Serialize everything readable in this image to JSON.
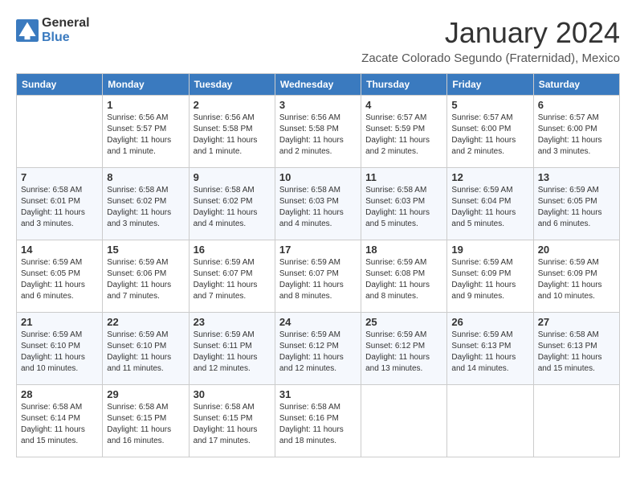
{
  "logo": {
    "general": "General",
    "blue": "Blue"
  },
  "title": {
    "month": "January 2024",
    "location": "Zacate Colorado Segundo (Fraternidad), Mexico"
  },
  "weekdays": [
    "Sunday",
    "Monday",
    "Tuesday",
    "Wednesday",
    "Thursday",
    "Friday",
    "Saturday"
  ],
  "weeks": [
    [
      {
        "day": "",
        "sunrise": "",
        "sunset": "",
        "daylight": ""
      },
      {
        "day": "1",
        "sunrise": "Sunrise: 6:56 AM",
        "sunset": "Sunset: 5:57 PM",
        "daylight": "Daylight: 11 hours and 1 minute."
      },
      {
        "day": "2",
        "sunrise": "Sunrise: 6:56 AM",
        "sunset": "Sunset: 5:58 PM",
        "daylight": "Daylight: 11 hours and 1 minute."
      },
      {
        "day": "3",
        "sunrise": "Sunrise: 6:56 AM",
        "sunset": "Sunset: 5:58 PM",
        "daylight": "Daylight: 11 hours and 2 minutes."
      },
      {
        "day": "4",
        "sunrise": "Sunrise: 6:57 AM",
        "sunset": "Sunset: 5:59 PM",
        "daylight": "Daylight: 11 hours and 2 minutes."
      },
      {
        "day": "5",
        "sunrise": "Sunrise: 6:57 AM",
        "sunset": "Sunset: 6:00 PM",
        "daylight": "Daylight: 11 hours and 2 minutes."
      },
      {
        "day": "6",
        "sunrise": "Sunrise: 6:57 AM",
        "sunset": "Sunset: 6:00 PM",
        "daylight": "Daylight: 11 hours and 3 minutes."
      }
    ],
    [
      {
        "day": "7",
        "sunrise": "Sunrise: 6:58 AM",
        "sunset": "Sunset: 6:01 PM",
        "daylight": "Daylight: 11 hours and 3 minutes."
      },
      {
        "day": "8",
        "sunrise": "Sunrise: 6:58 AM",
        "sunset": "Sunset: 6:02 PM",
        "daylight": "Daylight: 11 hours and 3 minutes."
      },
      {
        "day": "9",
        "sunrise": "Sunrise: 6:58 AM",
        "sunset": "Sunset: 6:02 PM",
        "daylight": "Daylight: 11 hours and 4 minutes."
      },
      {
        "day": "10",
        "sunrise": "Sunrise: 6:58 AM",
        "sunset": "Sunset: 6:03 PM",
        "daylight": "Daylight: 11 hours and 4 minutes."
      },
      {
        "day": "11",
        "sunrise": "Sunrise: 6:58 AM",
        "sunset": "Sunset: 6:03 PM",
        "daylight": "Daylight: 11 hours and 5 minutes."
      },
      {
        "day": "12",
        "sunrise": "Sunrise: 6:59 AM",
        "sunset": "Sunset: 6:04 PM",
        "daylight": "Daylight: 11 hours and 5 minutes."
      },
      {
        "day": "13",
        "sunrise": "Sunrise: 6:59 AM",
        "sunset": "Sunset: 6:05 PM",
        "daylight": "Daylight: 11 hours and 6 minutes."
      }
    ],
    [
      {
        "day": "14",
        "sunrise": "Sunrise: 6:59 AM",
        "sunset": "Sunset: 6:05 PM",
        "daylight": "Daylight: 11 hours and 6 minutes."
      },
      {
        "day": "15",
        "sunrise": "Sunrise: 6:59 AM",
        "sunset": "Sunset: 6:06 PM",
        "daylight": "Daylight: 11 hours and 7 minutes."
      },
      {
        "day": "16",
        "sunrise": "Sunrise: 6:59 AM",
        "sunset": "Sunset: 6:07 PM",
        "daylight": "Daylight: 11 hours and 7 minutes."
      },
      {
        "day": "17",
        "sunrise": "Sunrise: 6:59 AM",
        "sunset": "Sunset: 6:07 PM",
        "daylight": "Daylight: 11 hours and 8 minutes."
      },
      {
        "day": "18",
        "sunrise": "Sunrise: 6:59 AM",
        "sunset": "Sunset: 6:08 PM",
        "daylight": "Daylight: 11 hours and 8 minutes."
      },
      {
        "day": "19",
        "sunrise": "Sunrise: 6:59 AM",
        "sunset": "Sunset: 6:09 PM",
        "daylight": "Daylight: 11 hours and 9 minutes."
      },
      {
        "day": "20",
        "sunrise": "Sunrise: 6:59 AM",
        "sunset": "Sunset: 6:09 PM",
        "daylight": "Daylight: 11 hours and 10 minutes."
      }
    ],
    [
      {
        "day": "21",
        "sunrise": "Sunrise: 6:59 AM",
        "sunset": "Sunset: 6:10 PM",
        "daylight": "Daylight: 11 hours and 10 minutes."
      },
      {
        "day": "22",
        "sunrise": "Sunrise: 6:59 AM",
        "sunset": "Sunset: 6:10 PM",
        "daylight": "Daylight: 11 hours and 11 minutes."
      },
      {
        "day": "23",
        "sunrise": "Sunrise: 6:59 AM",
        "sunset": "Sunset: 6:11 PM",
        "daylight": "Daylight: 11 hours and 12 minutes."
      },
      {
        "day": "24",
        "sunrise": "Sunrise: 6:59 AM",
        "sunset": "Sunset: 6:12 PM",
        "daylight": "Daylight: 11 hours and 12 minutes."
      },
      {
        "day": "25",
        "sunrise": "Sunrise: 6:59 AM",
        "sunset": "Sunset: 6:12 PM",
        "daylight": "Daylight: 11 hours and 13 minutes."
      },
      {
        "day": "26",
        "sunrise": "Sunrise: 6:59 AM",
        "sunset": "Sunset: 6:13 PM",
        "daylight": "Daylight: 11 hours and 14 minutes."
      },
      {
        "day": "27",
        "sunrise": "Sunrise: 6:58 AM",
        "sunset": "Sunset: 6:13 PM",
        "daylight": "Daylight: 11 hours and 15 minutes."
      }
    ],
    [
      {
        "day": "28",
        "sunrise": "Sunrise: 6:58 AM",
        "sunset": "Sunset: 6:14 PM",
        "daylight": "Daylight: 11 hours and 15 minutes."
      },
      {
        "day": "29",
        "sunrise": "Sunrise: 6:58 AM",
        "sunset": "Sunset: 6:15 PM",
        "daylight": "Daylight: 11 hours and 16 minutes."
      },
      {
        "day": "30",
        "sunrise": "Sunrise: 6:58 AM",
        "sunset": "Sunset: 6:15 PM",
        "daylight": "Daylight: 11 hours and 17 minutes."
      },
      {
        "day": "31",
        "sunrise": "Sunrise: 6:58 AM",
        "sunset": "Sunset: 6:16 PM",
        "daylight": "Daylight: 11 hours and 18 minutes."
      },
      {
        "day": "",
        "sunrise": "",
        "sunset": "",
        "daylight": ""
      },
      {
        "day": "",
        "sunrise": "",
        "sunset": "",
        "daylight": ""
      },
      {
        "day": "",
        "sunrise": "",
        "sunset": "",
        "daylight": ""
      }
    ]
  ]
}
